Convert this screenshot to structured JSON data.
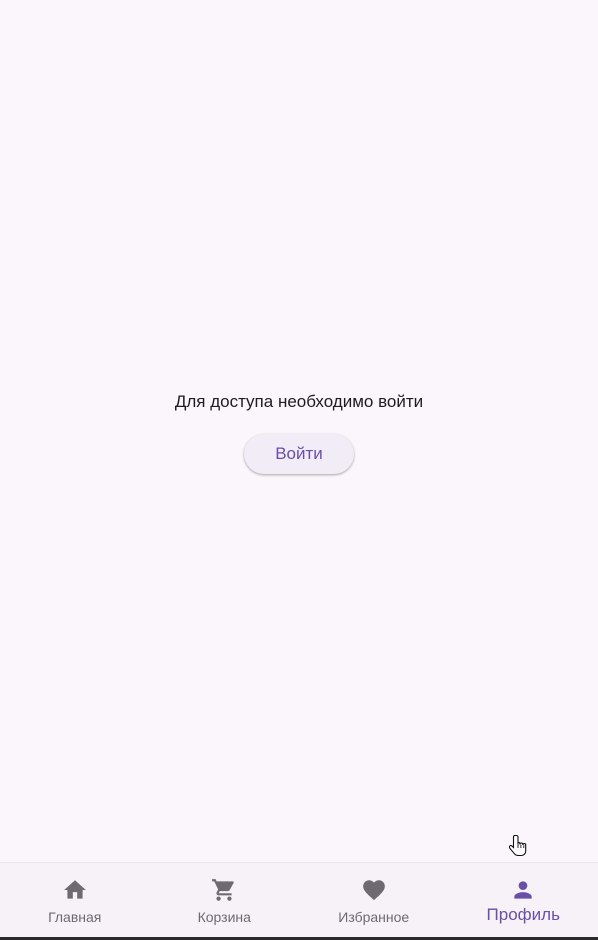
{
  "main": {
    "message": "Для доступа необходимо войти",
    "login_button": "Войти"
  },
  "bottom_nav": {
    "items": [
      {
        "label": "Главная",
        "icon": "home-icon"
      },
      {
        "label": "Корзина",
        "icon": "cart-icon"
      },
      {
        "label": "Избранное",
        "icon": "heart-icon"
      },
      {
        "label": "Профиль",
        "icon": "person-icon"
      }
    ],
    "active_index": 3
  },
  "colors": {
    "background": "#fbf6fb",
    "accent": "#6a4fa6",
    "inactive": "#6f6a72"
  }
}
